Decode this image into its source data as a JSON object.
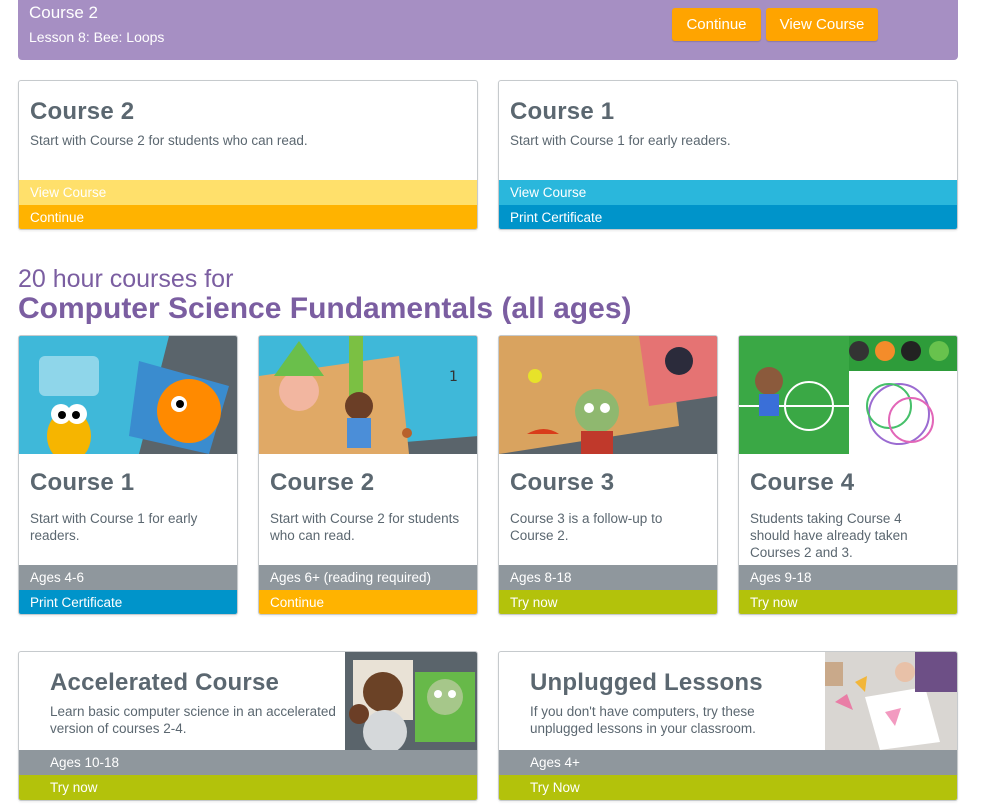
{
  "banner": {
    "course": "Course 2",
    "lesson": "Lesson 8: Bee: Loops",
    "continue_label": "Continue",
    "view_course_label": "View Course"
  },
  "progress_cards": [
    {
      "title": "Course 2",
      "description": "Start with Course 2 for students who can read.",
      "bar1": "View Course",
      "bar2": "Continue"
    },
    {
      "title": "Course 1",
      "description": "Start with Course 1 for early readers.",
      "bar1": "View Course",
      "bar2": "Print Certificate"
    }
  ],
  "section": {
    "small": "20 hour courses for",
    "big": "Computer Science Fundamentals (all ages)"
  },
  "courses": [
    {
      "title": "Course 1",
      "description": "Start with Course 1 for early readers.",
      "ages": "Ages 4-6",
      "action": "Print Certificate"
    },
    {
      "title": "Course 2",
      "description": "Start with Course 2 for students who can read.",
      "ages": "Ages 6+ (reading required)",
      "action": "Continue"
    },
    {
      "title": "Course 3",
      "description": "Course 3 is a follow-up to Course 2.",
      "ages": "Ages 8-18",
      "action": "Try now"
    },
    {
      "title": "Course 4",
      "description": "Students taking Course 4 should have already taken Courses 2 and 3.",
      "ages": "Ages 9-18",
      "action": "Try now"
    }
  ],
  "wide_cards": [
    {
      "title": "Accelerated Course",
      "description": "Learn basic computer science in an accelerated version of courses 2-4.",
      "ages": "Ages 10-18",
      "action": "Try now"
    },
    {
      "title": "Unplugged Lessons",
      "description": "If you don't have computers, try these unplugged lessons in your classroom.",
      "ages": "Ages 4+",
      "action": "Try Now"
    }
  ],
  "colors": {
    "banner": "#a68fc3",
    "orange": "#ffa400",
    "light_yellow": "#ffe06b",
    "light_blue": "#2ab7dc",
    "dark_blue": "#0094ca",
    "gray_bar": "#8f979d",
    "lime": "#b3c20b",
    "purple_heading": "#7b5ea1"
  }
}
